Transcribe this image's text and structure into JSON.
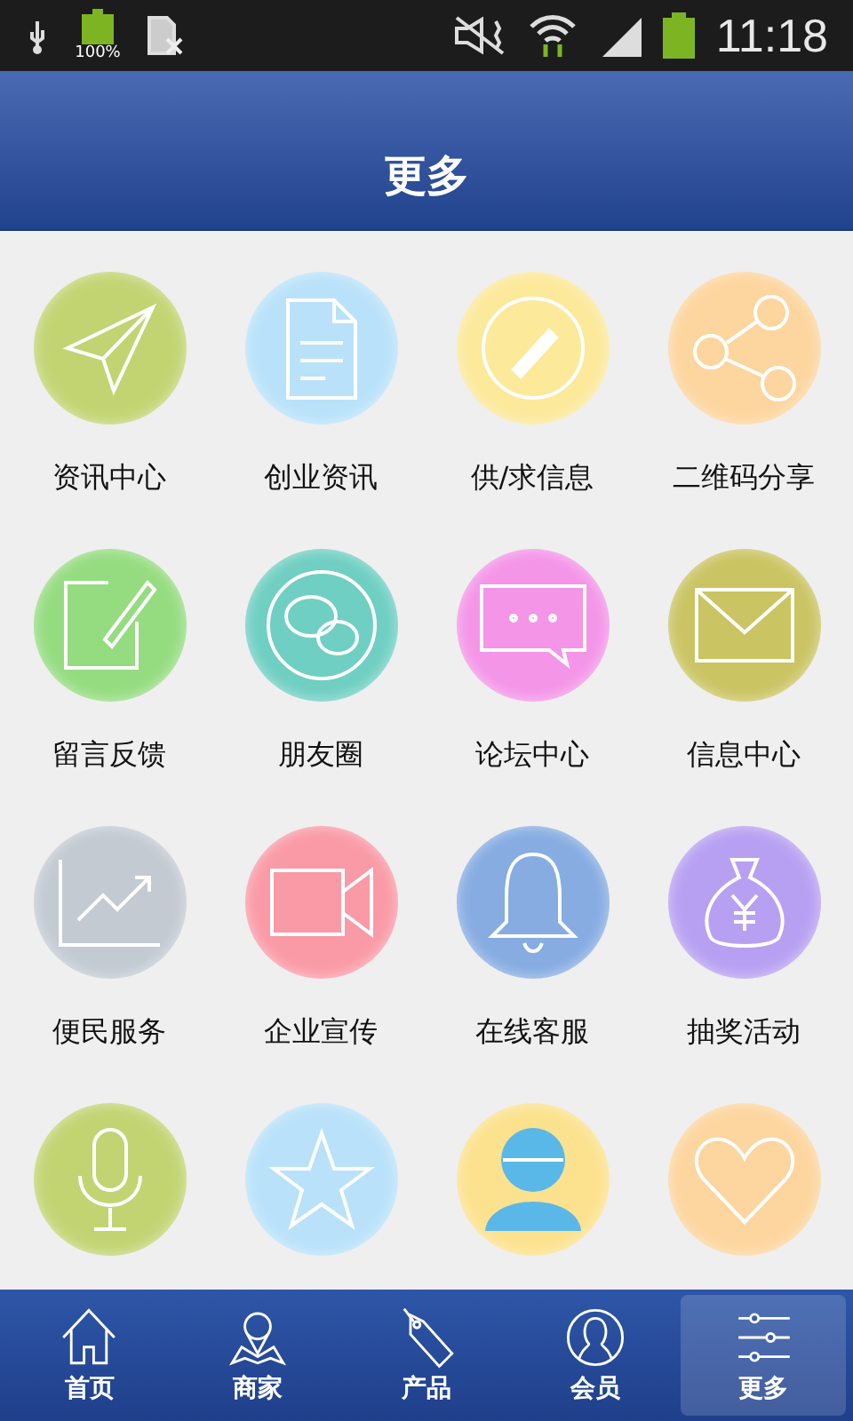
{
  "status_bar": {
    "battery_label": "100%",
    "time": "11:18"
  },
  "header": {
    "title": "更多"
  },
  "tiles": [
    {
      "label": "资讯中心",
      "color": "#c2d472"
    },
    {
      "label": "创业资讯",
      "color": "#b9e2fa"
    },
    {
      "label": "供/求信息",
      "color": "#fce99a"
    },
    {
      "label": "二维码分享",
      "color": "#fdd59e"
    },
    {
      "label": "留言反馈",
      "color": "#95dc80"
    },
    {
      "label": "朋友圈",
      "color": "#6fcfc2"
    },
    {
      "label": "论坛中心",
      "color": "#f495e8"
    },
    {
      "label": "信息中心",
      "color": "#cac462"
    },
    {
      "label": "便民服务",
      "color": "#c3cad2"
    },
    {
      "label": "企业宣传",
      "color": "#fa9aa6"
    },
    {
      "label": "在线客服",
      "color": "#86ace2"
    },
    {
      "label": "抽奖活动",
      "color": "#b7a0f2"
    },
    {
      "color": "#c2d472"
    },
    {
      "color": "#b9e2fa"
    },
    {
      "color": "#fce28e"
    },
    {
      "color": "#fdd59e"
    }
  ],
  "nav": [
    {
      "label": "首页",
      "selected": false
    },
    {
      "label": "商家",
      "selected": false
    },
    {
      "label": "产品",
      "selected": false
    },
    {
      "label": "会员",
      "selected": false
    },
    {
      "label": "更多",
      "selected": true
    }
  ]
}
